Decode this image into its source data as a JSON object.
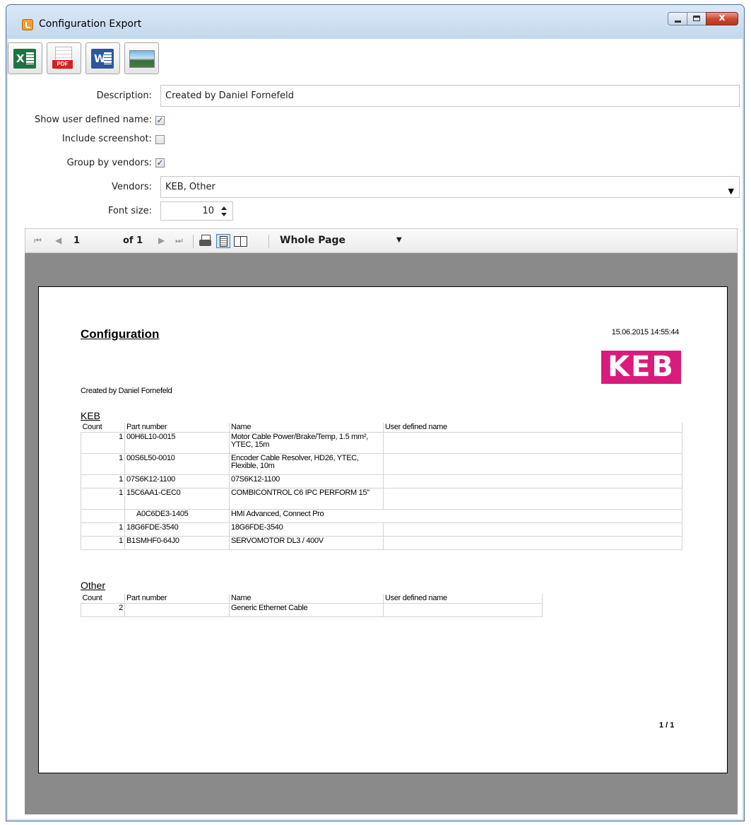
{
  "window": {
    "title": "Configuration Export",
    "close_glyph": "x"
  },
  "toolbar": {
    "excel_label": "X",
    "pdf_label": "PDF",
    "word_label": "W"
  },
  "form": {
    "description_label": "Description:",
    "description_value": "Created by Daniel Fornefeld",
    "show_user_defined_name_label": "Show user defined name:",
    "show_user_defined_name_checked": true,
    "include_screenshot_label": "Include screenshot:",
    "include_screenshot_checked": false,
    "group_by_vendors_label": "Group by vendors:",
    "group_by_vendors_checked": true,
    "vendors_label": "Vendors:",
    "vendors_value": "KEB, Other",
    "font_size_label": "Font size:",
    "font_size_value": "10"
  },
  "viewer": {
    "current_page": "1",
    "of_pages": "of 1",
    "zoom": "Whole Page"
  },
  "report": {
    "title": "Configuration",
    "date": "15.06.2015 14:55:44",
    "logo": "KEB",
    "description": "Created by Daniel Fornefeld",
    "page_footer": "1 / 1",
    "columns": [
      "Count",
      "Part number",
      "Name",
      "User defined name"
    ],
    "groups": [
      {
        "name": "KEB",
        "rows": [
          {
            "count": "1",
            "part": "00H6L10-0015",
            "name": "Motor Cable Power/Brake/Temp, 1.5 mm², YTEC, 15m",
            "user_name": ""
          },
          {
            "count": "1",
            "part": "00S6L50-0010",
            "name": "Encoder Cable Resolver, HD26, YTEC, Flexible, 10m",
            "user_name": ""
          },
          {
            "count": "1",
            "part": "07S6K12-1100",
            "name": "07S6K12-1100",
            "user_name": ""
          },
          {
            "count": "1",
            "part": "15C6AA1-CEC0",
            "name": "COMBICONTROL C6 IPC PERFORM 15\"",
            "user_name": ""
          },
          {
            "count": "",
            "part": "A0C6DE3-1405",
            "name": "HMI Advanced, Connect Pro",
            "user_name": "",
            "indent": true
          },
          {
            "count": "1",
            "part": "18G6FDE-3540",
            "name": "18G6FDE-3540",
            "user_name": ""
          },
          {
            "count": "1",
            "part": "B1SMHF0-64J0",
            "name": "SERVOMOTOR DL3 / 400V",
            "user_name": ""
          }
        ]
      },
      {
        "name": "Other",
        "rows": [
          {
            "count": "2",
            "part": "",
            "name": "Generic Ethernet Cable",
            "user_name": ""
          }
        ]
      }
    ]
  },
  "colors": {
    "titlebar": "#c9ddf2",
    "viewer_bg": "#8a8a8a",
    "keb_magenta": "#d91b7c",
    "checkmark": "#2a3f9e"
  }
}
